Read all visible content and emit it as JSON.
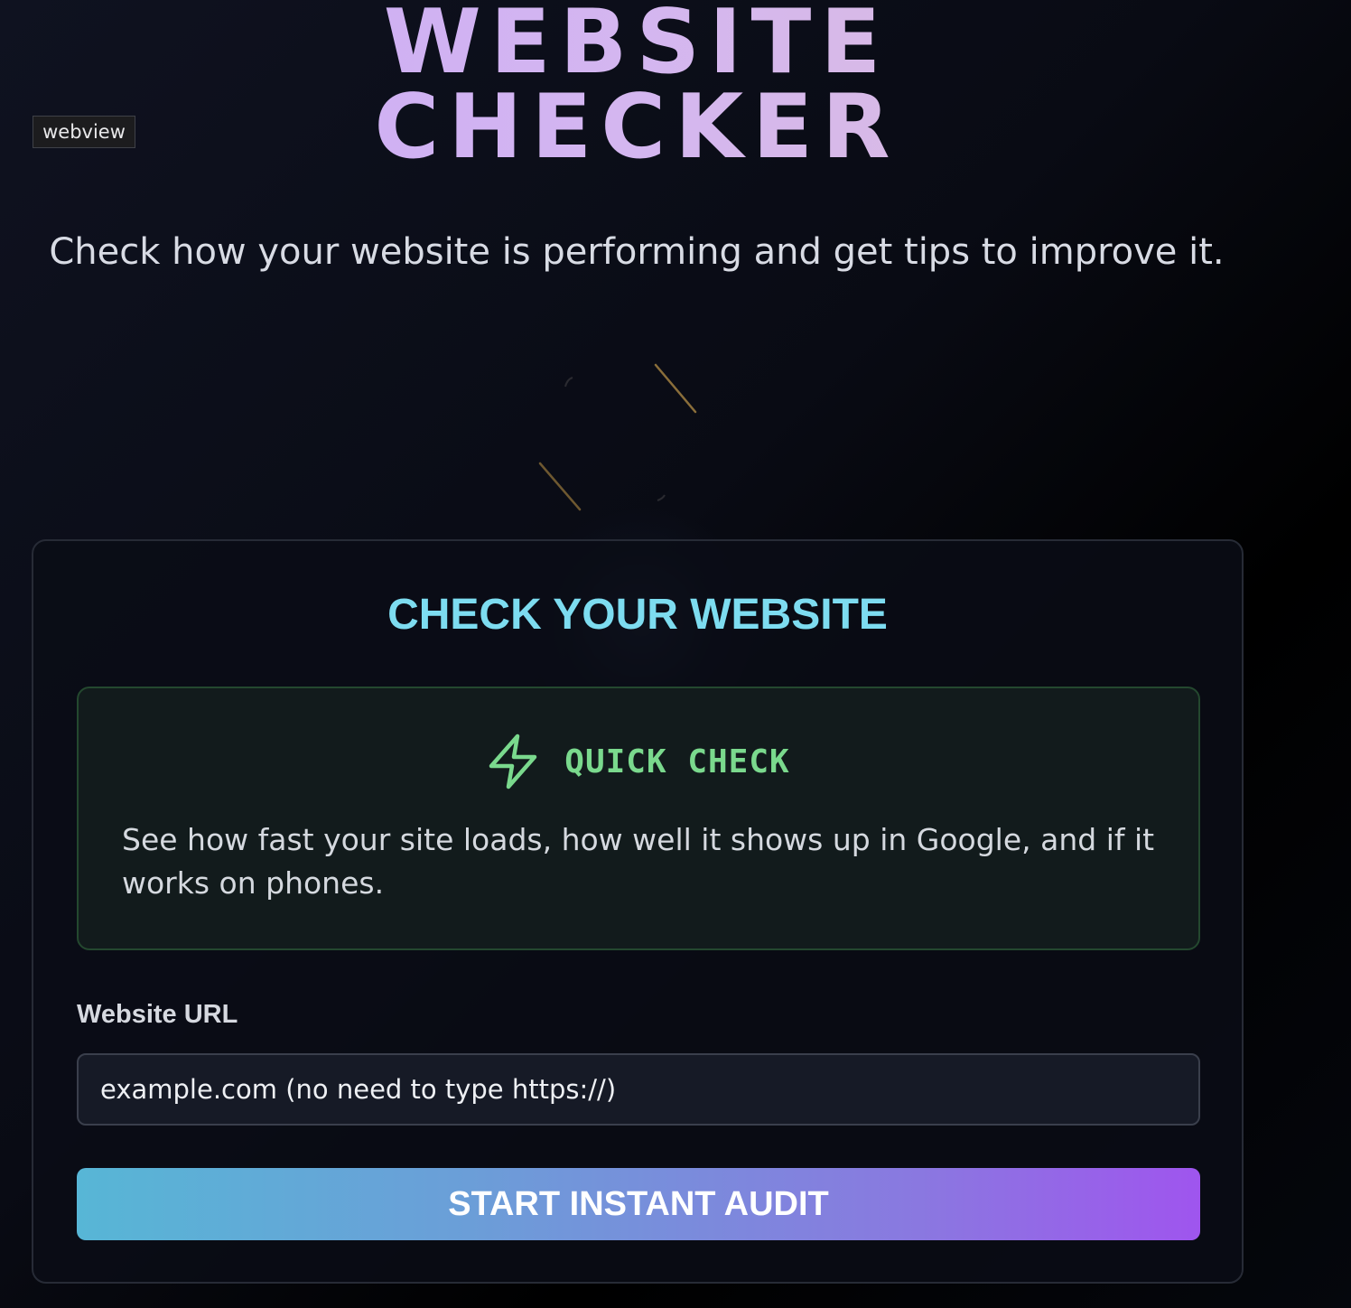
{
  "webview_tag": "webview",
  "hero": {
    "title_line1": "WEBSITE",
    "title_line2": "CHECKER",
    "subtitle": "Check how your website is performing and get tips to improve it."
  },
  "card": {
    "title": "CHECK YOUR WEBSITE",
    "quick_check": {
      "icon": "lightning-bolt-icon",
      "label": "QUICK CHECK",
      "description": "See how fast your site loads, how well it shows up in Google, and if it works on phones."
    },
    "url_field": {
      "label": "Website URL",
      "value": "",
      "placeholder": "example.com (no need to type https://)"
    },
    "submit_label": "START INSTANT AUDIT"
  },
  "colors": {
    "title_gradient_start": "#c9a9f7",
    "title_gradient_end": "#ddbfd9",
    "card_title": "#7ddcf0",
    "quick_check_accent": "#7ad98d",
    "button_gradient_start": "#57b6d6",
    "button_gradient_end": "#9f55ee"
  }
}
